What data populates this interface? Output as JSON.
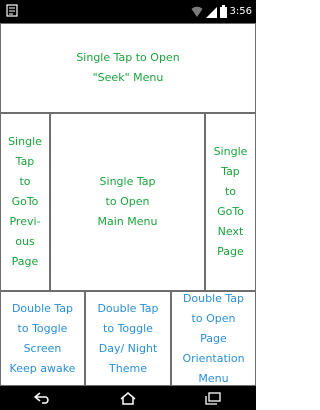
{
  "status_bar": {
    "time": "3:56",
    "icons": [
      "notification-icon",
      "wifi-icon",
      "cellular-signal-icon",
      "battery-icon"
    ]
  },
  "zones": {
    "seek": {
      "line1": "Single Tap to Open",
      "line2": "\"Seek\" Menu"
    },
    "prev": {
      "lines": [
        "Single",
        "Tap",
        "to",
        "GoTo",
        "Previ-",
        "ous",
        "Page"
      ]
    },
    "main": {
      "line1": "Single Tap",
      "line2": "to Open",
      "line3": "Main Menu"
    },
    "next": {
      "lines": [
        "Single",
        "Tap",
        "to",
        "GoTo",
        "Next",
        "Page"
      ]
    },
    "awake": {
      "line1": "Double Tap",
      "line2": "to Toggle",
      "line3": "Screen",
      "line4": "Keep awake"
    },
    "theme": {
      "line1": "Double Tap",
      "line2": "to Toggle",
      "line3": "Day/ Night",
      "line4": "Theme"
    },
    "orient": {
      "line1": "Double Tap",
      "line2": "to Open",
      "line3": "Page",
      "line4": "Orientation",
      "line5": "Menu"
    }
  },
  "nav_bar": {
    "icons": [
      "back-icon",
      "home-icon",
      "recent-apps-icon"
    ]
  },
  "colors": {
    "single_tap_text": "#1ba33b",
    "double_tap_text": "#2a8fd6",
    "border": "#6e6e6e"
  }
}
